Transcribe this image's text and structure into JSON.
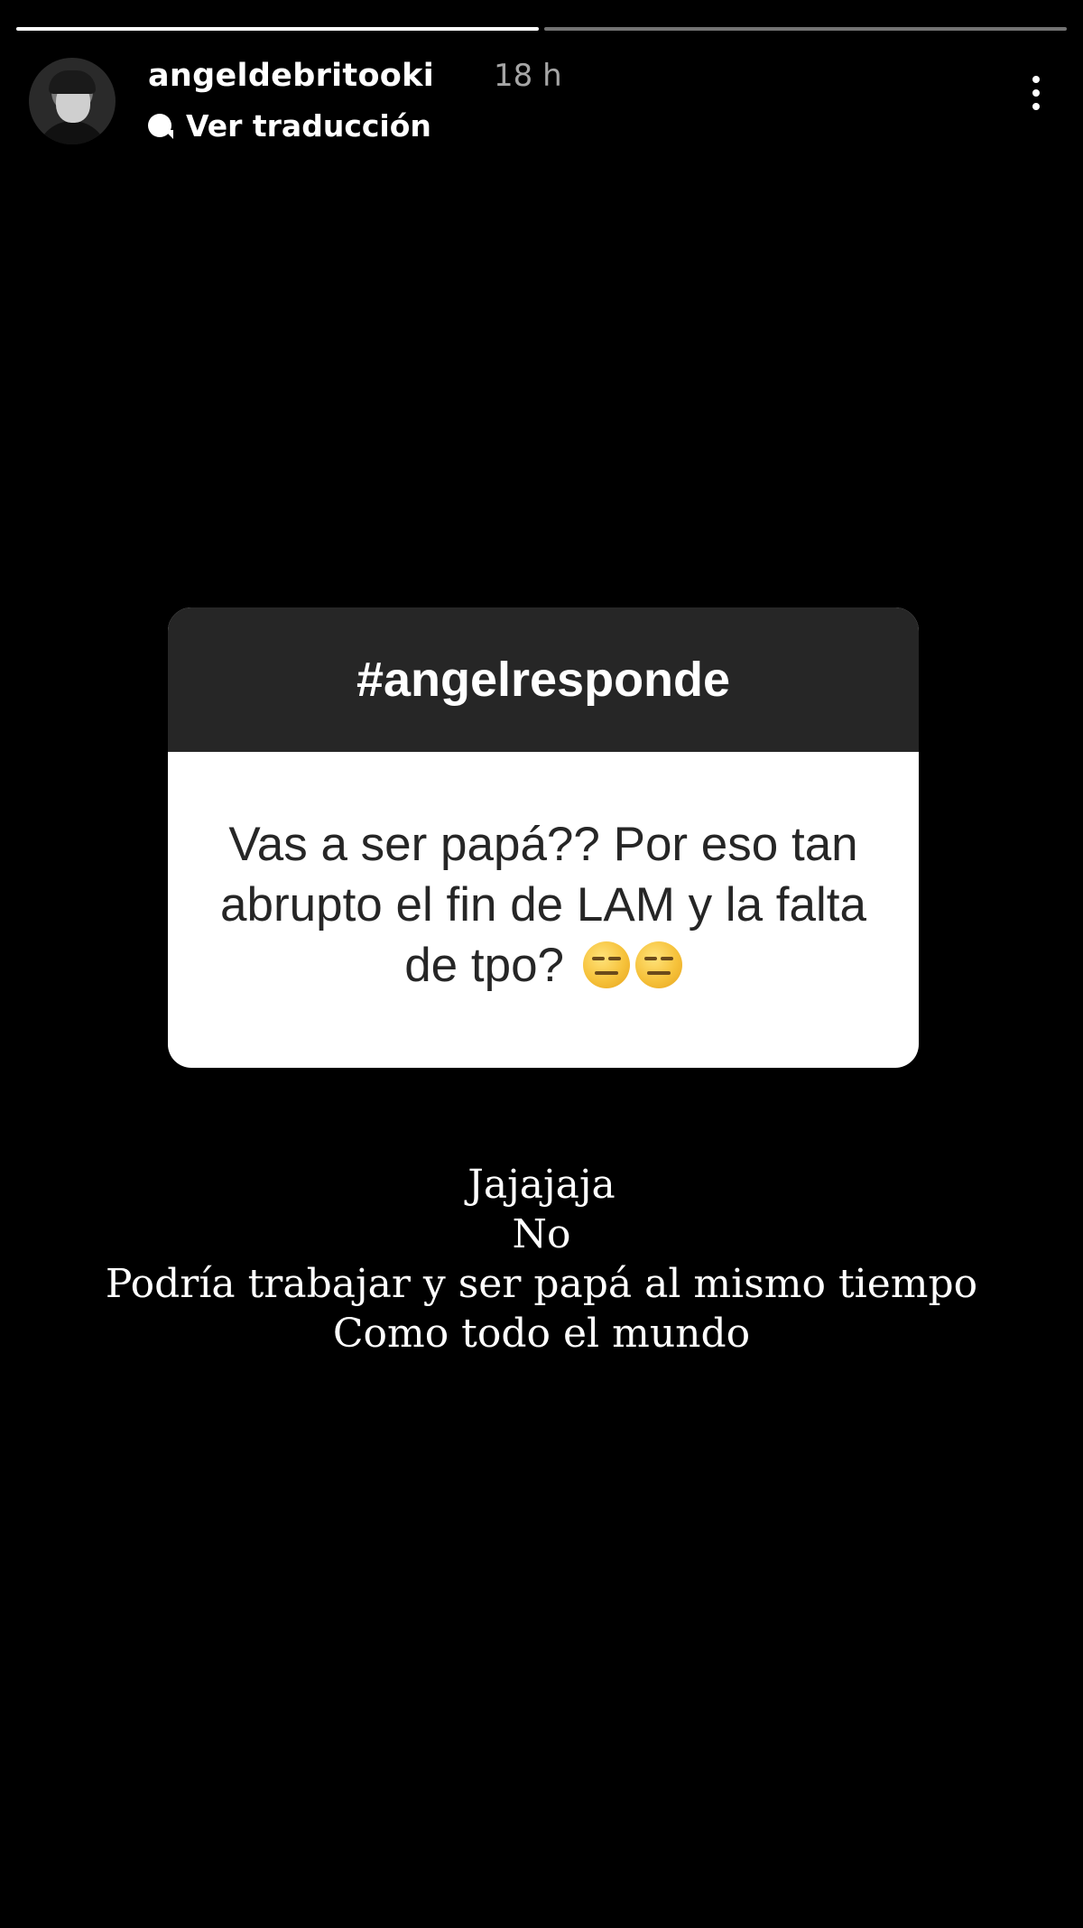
{
  "story": {
    "segments_total": 2,
    "segments_seen": 1
  },
  "header": {
    "username": "angeldebritooki",
    "time_ago": "18 h",
    "translate_icon": "speech-bubble-icon",
    "translate_label": "Ver traducción",
    "more_icon": "more-vertical-icon"
  },
  "sticker": {
    "title": "#angelresponde",
    "question": "Vas a ser papá?? Por eso tan abrupto el fin de LAM y la falta de tpo?",
    "emojis": [
      "expressionless-face-icon",
      "expressionless-face-icon"
    ]
  },
  "answer": {
    "lines": [
      "Jajajaja",
      "No",
      "Podría trabajar y ser papá al mismo tiempo",
      "Como todo el mundo"
    ]
  },
  "colors": {
    "background": "#000000",
    "sticker_header": "#262626",
    "sticker_body": "#ffffff"
  }
}
